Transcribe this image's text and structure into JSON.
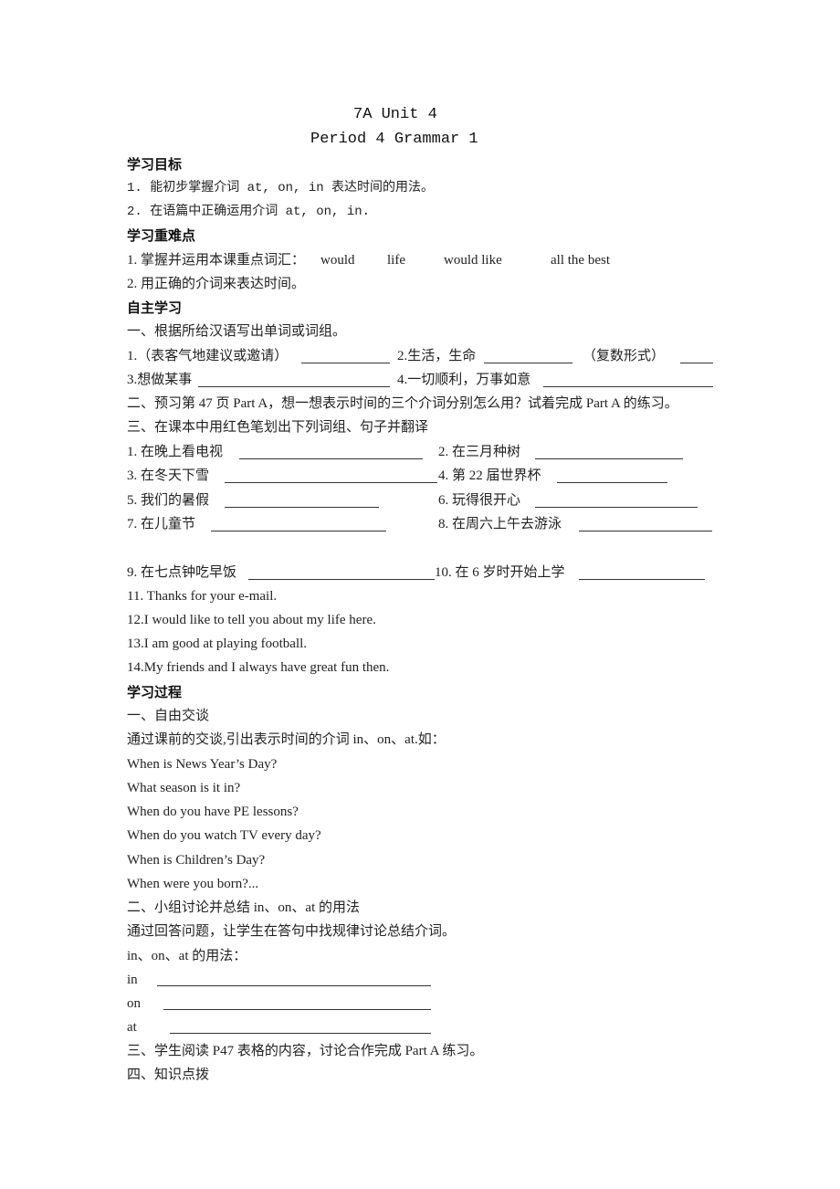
{
  "header": {
    "title": "7A Unit 4",
    "subtitle": "Period 4  Grammar 1"
  },
  "objectives": {
    "heading": "学习目标",
    "items": [
      "1.  能初步掌握介词 at, on, in 表达时间的用法。",
      "2.  在语篇中正确运用介词 at, on, in."
    ]
  },
  "key_points": {
    "heading": "学习重难点",
    "item1_prefix": "1. 掌握并运用本课重点词汇：",
    "vocab": [
      "would",
      "life",
      "would like",
      "all the best"
    ],
    "item2": "2. 用正确的介词来表达时间。"
  },
  "self_study": {
    "heading": "自主学习",
    "part1_title": "一、根据所给汉语写出单词或词组。",
    "part1_items": [
      "1.（表客气地建议或邀请）",
      "2.生活，生命",
      "（复数形式）",
      "3.想做某事",
      "4.一切顺利，万事如意"
    ],
    "part2_title": "二、预习第 47 页 Part A，想一想表示时间的三个介词分别怎么用？试着完成 Part A  的练习。",
    "part3_title": "三、在课本中用红色笔划出下列词组、句子并翻译",
    "phrases": [
      "1. 在晚上看电视",
      "2. 在三月种树",
      "3. 在冬天下雪",
      "4. 第 22 届世界杯",
      "5. 我们的暑假",
      "6. 玩得很开心",
      "7. 在儿童节",
      "8. 在周六上午去游泳",
      "9. 在七点钟吃早饭",
      "10. 在 6 岁时开始上学"
    ],
    "sentences": [
      "11. Thanks for your e-mail.",
      "12.I would like to tell you about my life here.",
      "13.I am good at playing football.",
      "14.My friends and I always have great fun then."
    ]
  },
  "process": {
    "heading": "学习过程",
    "step1_title": "一、自由交谈",
    "step1_intro": "通过课前的交谈,引出表示时间的介词 in、on、at.如：",
    "questions": [
      "When is News Year’s Day?",
      "What season is it in?",
      "When do you have PE lessons?",
      "When do you watch TV every day?",
      "When is Children’s Day?",
      "When were you born?..."
    ],
    "step2_title": "二、小组讨论并总结 in、on、at 的用法",
    "step2_intro": "通过回答问题，让学生在答句中找规律讨论总结介词。",
    "usage_title": "in、on、at 的用法：",
    "usage_labels": [
      "in",
      "on",
      "at"
    ],
    "step3_title": "三、学生阅读 P47 表格的内容，讨论合作完成 Part A 练习。",
    "step4_title": "四、知识点拨"
  }
}
